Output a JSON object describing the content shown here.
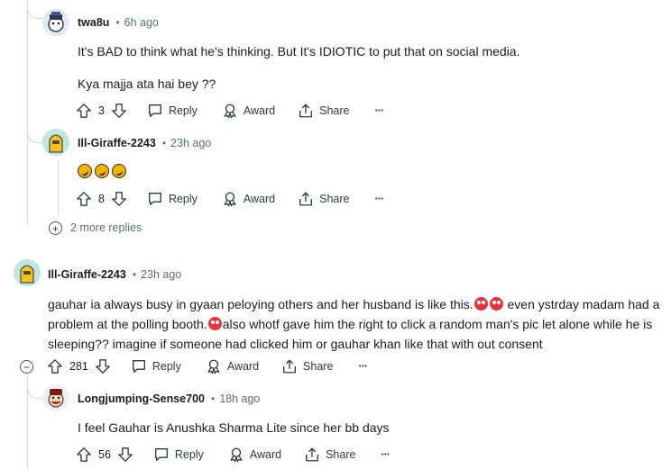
{
  "comments": [
    {
      "author": "twa8u",
      "time": "6h ago",
      "lines": [
        "It's BAD to think what he's thinking.  But It's IDIOTIC to put that on social media.",
        "Kya majja ata hai bey ??"
      ],
      "votes": "3",
      "reply_label": "Reply",
      "award_label": "Award",
      "share_label": "Share"
    },
    {
      "author": "Ill-Giraffe-2243",
      "time": "23h ago",
      "emoji": [
        "rolling-laughing-emoji",
        "rolling-laughing-emoji",
        "rolling-laughing-emoji"
      ],
      "votes": "8",
      "reply_label": "Reply",
      "award_label": "Award",
      "share_label": "Share"
    },
    {
      "author": "Ill-Giraffe-2243",
      "time": "23h ago",
      "line1a": "gauhar ia always busy in gyaan peloying others and her husband is like this.",
      "line1b": " even ystrday madam had a",
      "line2a": "problem at the polling booth.",
      "line2b": "also whotf gave him the right to click a random man's pic let alone while he is",
      "line3": "sleeping?? imagine if someone had clicked him or gauhar khan like that with out consent",
      "votes": "281",
      "reply_label": "Reply",
      "award_label": "Award",
      "share_label": "Share"
    },
    {
      "author": "Longjumping-Sense700",
      "time": "18h ago",
      "text": "I feel Gauhar is Anushka Sharma Lite since her bb days",
      "votes": "56",
      "reply_label": "Reply",
      "award_label": "Award",
      "share_label": "Share"
    }
  ],
  "more_replies": "2 more replies",
  "separator": "•",
  "more_icon": "···",
  "expand_symbol": "+",
  "collapse_symbol": "−"
}
